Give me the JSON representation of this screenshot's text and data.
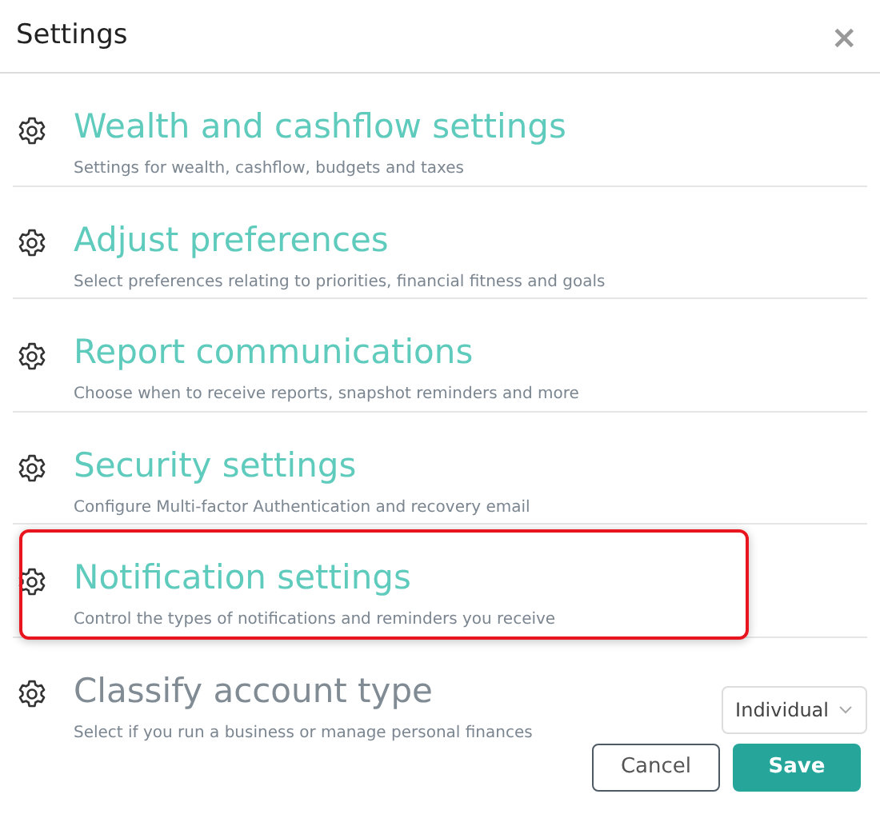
{
  "window": {
    "title": "Settings",
    "close": "×"
  },
  "items": [
    {
      "kind": "link",
      "title": "Wealth and cashflow settings",
      "description": "Settings for wealth, cashflow, budgets and taxes",
      "highlighted": false
    },
    {
      "kind": "link",
      "title": "Adjust preferences",
      "description": "Select preferences relating to priorities, financial fitness and goals",
      "highlighted": false
    },
    {
      "kind": "link",
      "title": "Report communications",
      "description": "Choose when to receive reports, snapshot reminders and more",
      "highlighted": false
    },
    {
      "kind": "link",
      "title": "Security settings",
      "description": "Configure Multi-factor Authentication and recovery email",
      "highlighted": false
    },
    {
      "kind": "link",
      "title": "Notification settings",
      "description": "Control the types of notifications and reminders you receive",
      "highlighted": true
    },
    {
      "kind": "select",
      "title": "Classify account type",
      "description": "Select if you run a business or manage personal finances",
      "highlighted": false,
      "value": "Individual"
    }
  ],
  "buttons": [
    {
      "kind": "secondary",
      "label": "Cancel"
    },
    {
      "kind": "primary",
      "label": "Save"
    }
  ]
}
